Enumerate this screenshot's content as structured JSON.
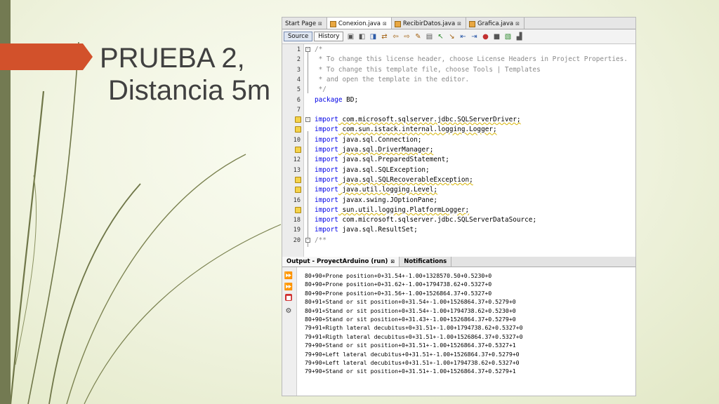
{
  "slide": {
    "title_line1": "PRUEBA 2,",
    "title_line2": "Distancia 5m",
    "accent_color": "#d2512b",
    "bar_color": "#737a52"
  },
  "editor_tabs": [
    {
      "label": "Start Page",
      "icon": "start-page-icon",
      "active": false
    },
    {
      "label": "Conexion.java",
      "icon": "java-file-icon",
      "active": true
    },
    {
      "label": "RecibirDatos.java",
      "icon": "java-file-icon",
      "active": false
    },
    {
      "label": "Grafica.java",
      "icon": "java-file-icon",
      "active": false
    }
  ],
  "toolbar": {
    "source_label": "Source",
    "history_label": "History"
  },
  "code_lines": [
    {
      "n": "1",
      "text": "/*",
      "style": "cm",
      "fold": "-",
      "hint": false
    },
    {
      "n": "2",
      "text": " * To change this license header, choose License Headers in Project Properties.",
      "style": "cm",
      "fold": "",
      "hint": false
    },
    {
      "n": "3",
      "text": " * To change this template file, choose Tools | Templates",
      "style": "cm",
      "fold": "",
      "hint": false
    },
    {
      "n": "4",
      "text": " * and open the template in the editor.",
      "style": "cm",
      "fold": "",
      "hint": false
    },
    {
      "n": "5",
      "text": " */",
      "style": "cm",
      "fold": "",
      "hint": false
    },
    {
      "n": "6",
      "kw": "package",
      "rest": " BD;",
      "style": "kw",
      "fold": "",
      "hint": false
    },
    {
      "n": "7",
      "text": "",
      "style": "pl",
      "fold": "",
      "hint": false
    },
    {
      "n": "",
      "kw": "import",
      "rest": " com.microsoft.sqlserver.jdbc.SQLServerDriver;",
      "style": "kw",
      "fold": "-",
      "hint": true,
      "warn": true
    },
    {
      "n": "",
      "kw": "import",
      "rest": " com.sun.istack.internal.logging.Logger;",
      "style": "kw",
      "fold": "",
      "hint": true,
      "warn": true
    },
    {
      "n": "10",
      "kw": "import",
      "rest": " java.sql.Connection;",
      "style": "kw",
      "fold": "",
      "hint": false
    },
    {
      "n": "",
      "kw": "import",
      "rest": " java.sql.DriverManager;",
      "style": "kw",
      "fold": "",
      "hint": true,
      "warn": true
    },
    {
      "n": "12",
      "kw": "import",
      "rest": " java.sql.PreparedStatement;",
      "style": "kw",
      "fold": "",
      "hint": false
    },
    {
      "n": "13",
      "kw": "import",
      "rest": " java.sql.SQLException;",
      "style": "kw",
      "fold": "",
      "hint": false
    },
    {
      "n": "",
      "kw": "import",
      "rest": " java.sql.SQLRecoverableException;",
      "style": "kw",
      "fold": "",
      "hint": true,
      "warn": true
    },
    {
      "n": "",
      "kw": "import",
      "rest": " java.util.logging.Level;",
      "style": "kw",
      "fold": "",
      "hint": true,
      "warn": true
    },
    {
      "n": "16",
      "kw": "import",
      "rest": " javax.swing.JOptionPane;",
      "style": "kw",
      "fold": "",
      "hint": false
    },
    {
      "n": "",
      "kw": "import",
      "rest": " sun.util.logging.PlatformLogger;",
      "style": "kw",
      "fold": "",
      "hint": true,
      "warn": true
    },
    {
      "n": "18",
      "kw": "import",
      "rest": " com.microsoft.sqlserver.jdbc.SQLServerDataSource;",
      "style": "kw",
      "fold": "",
      "hint": false
    },
    {
      "n": "19",
      "kw": "import",
      "rest": " java.sql.ResultSet;",
      "style": "kw",
      "fold": "",
      "hint": false
    },
    {
      "n": "20",
      "text": "/**",
      "style": "cm",
      "fold": "-",
      "hint": false
    }
  ],
  "output_tabs": [
    {
      "label": "Output - ProyectArduino (run)",
      "active": true
    },
    {
      "label": "Notifications",
      "active": false
    }
  ],
  "output_lines": [
    "80+90+Prone position+0+31.54+-1.00+1328570.50+0.5230+0",
    "80+90+Prone position+0+31.62+-1.00+1794738.62+0.5327+0",
    "80+90+Prone position+0+31.56+-1.00+1526864.37+0.5327+0",
    "80+91+Stand or sit position+0+31.54+-1.00+1526864.37+0.5279+0",
    "80+91+Stand or sit position+0+31.54+-1.00+1794738.62+0.5230+0",
    "80+90+Stand or sit position+0+31.43+-1.00+1526864.37+0.5279+0",
    "79+91+Rigth lateral decubitus+0+31.51+-1.00+1794738.62+0.5327+0",
    "79+91+Rigth lateral decubitus+0+31.51+-1.00+1526864.37+0.5327+0",
    "79+90+Stand or sit position+0+31.51+-1.00+1526864.37+0.5327+1",
    "79+90+Left lateral decubitus+0+31.51+-1.00+1526864.37+0.5279+0",
    "79+90+Left lateral decubitus+0+31.51+-1.00+1794738.62+0.5327+0",
    "79+90+Stand or sit position+0+31.51+-1.00+1526864.37+0.5279+1"
  ],
  "output_side_icons": [
    "rerun-icon",
    "rerun-with-args-icon",
    "stop-icon",
    "settings-icon"
  ]
}
